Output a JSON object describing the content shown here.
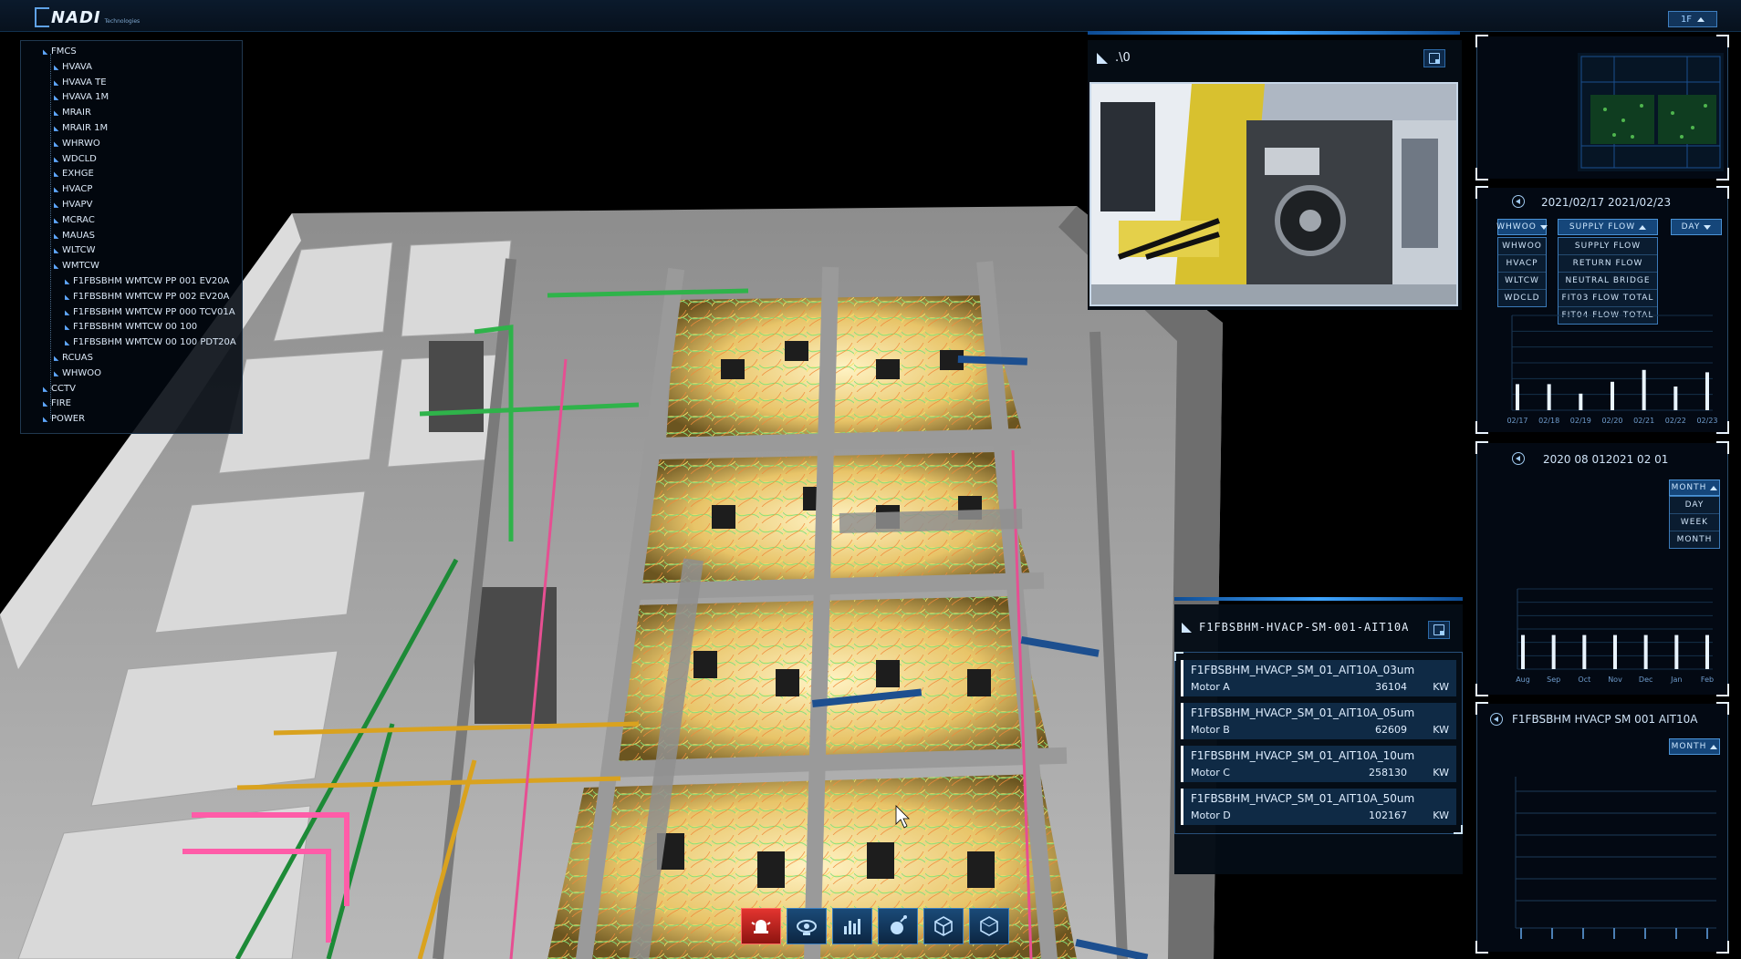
{
  "brand": {
    "name": "NADI",
    "tagline": "Technologies"
  },
  "floor_selector": {
    "value": "1F"
  },
  "tree": [
    {
      "label": "FMCS",
      "depth": 0
    },
    {
      "label": "HVAVA",
      "depth": 1
    },
    {
      "label": "HVAVA TE",
      "depth": 1
    },
    {
      "label": "HVAVA 1M",
      "depth": 1
    },
    {
      "label": "MRAIR",
      "depth": 1
    },
    {
      "label": "MRAIR 1M",
      "depth": 1
    },
    {
      "label": "WHRWO",
      "depth": 1
    },
    {
      "label": "WDCLD",
      "depth": 1
    },
    {
      "label": "EXHGE",
      "depth": 1
    },
    {
      "label": "HVACP",
      "depth": 1
    },
    {
      "label": "HVAPV",
      "depth": 1
    },
    {
      "label": "MCRAC",
      "depth": 1
    },
    {
      "label": "MAUAS",
      "depth": 1
    },
    {
      "label": "WLTCW",
      "depth": 1
    },
    {
      "label": "WMTCW",
      "depth": 1
    },
    {
      "label": "F1FBSBHM WMTCW PP 001 EV20A",
      "depth": 2
    },
    {
      "label": "F1FBSBHM WMTCW PP 002 EV20A",
      "depth": 2
    },
    {
      "label": "F1FBSBHM WMTCW PP 000 TCV01A",
      "depth": 2
    },
    {
      "label": "F1FBSBHM WMTCW 00 100",
      "depth": 2
    },
    {
      "label": "F1FBSBHM WMTCW 00 100 PDT20A",
      "depth": 2
    },
    {
      "label": "RCUAS",
      "depth": 1
    },
    {
      "label": "WHWOO",
      "depth": 1
    },
    {
      "label": "CCTV",
      "depth": 0
    },
    {
      "label": "FIRE",
      "depth": 0
    },
    {
      "label": "POWER",
      "depth": 0
    }
  ],
  "camera": {
    "title": ".\\0"
  },
  "sensor_panel": {
    "title": "F1FBSBHM-HVACP-SM-001-AIT10A",
    "rows": [
      {
        "name": "F1FBSBHM_HVACP_SM_01_AIT10A_03um",
        "motor": "Motor A",
        "value": "36104",
        "unit": "KW"
      },
      {
        "name": "F1FBSBHM_HVACP_SM_01_AIT10A_05um",
        "motor": "Motor B",
        "value": "62609",
        "unit": "KW"
      },
      {
        "name": "F1FBSBHM_HVACP_SM_01_AIT10A_10um",
        "motor": "Motor C",
        "value": "258130",
        "unit": "KW"
      },
      {
        "name": "F1FBSBHM_HVACP_SM_01_AIT10A_50um",
        "motor": "Motor D",
        "value": "102167",
        "unit": "KW"
      }
    ]
  },
  "flow_panel": {
    "date_range": "2021/02/17 2021/02/23",
    "system_select": {
      "value": "WHWOO",
      "options": [
        "WHWOO",
        "HVACP",
        "WLTCW",
        "WDCLD"
      ]
    },
    "metric_select": {
      "value": "SUPPLY FLOW",
      "options": [
        "SUPPLY FLOW",
        "RETURN FLOW",
        "NEUTRAL BRIDGE",
        "FIT03 FLOW TOTAL",
        "FIT04 FLOW TOTAL"
      ]
    },
    "period_select": {
      "value": "DAY"
    }
  },
  "monthly_panel": {
    "date_range": "2020 08 012021 02 01",
    "period_select": {
      "value": "MONTH",
      "options": [
        "DAY",
        "WEEK",
        "MONTH"
      ]
    }
  },
  "sensor_chart_panel": {
    "title": "F1FBSBHM HVACP SM 001 AIT10A",
    "period_select": {
      "value": "MONTH"
    }
  },
  "chart_data": [
    {
      "type": "bar",
      "categories": [
        "02/17",
        "02/18",
        "02/19",
        "02/20",
        "02/21",
        "02/22",
        "02/23"
      ],
      "values": [
        0.55,
        0.55,
        0.35,
        0.6,
        0.85,
        0.5,
        0.8
      ]
    },
    {
      "type": "bar",
      "categories": [
        "Aug",
        "Sep",
        "Oct",
        "Nov",
        "Dec",
        "Jan",
        "Feb"
      ],
      "values": [
        0.85,
        0.85,
        0.85,
        0.85,
        0.85,
        0.85,
        0.85
      ]
    }
  ],
  "toolbar": [
    {
      "icon": "alarm-icon",
      "active": true
    },
    {
      "icon": "camera-icon",
      "active": false
    },
    {
      "icon": "bar-chart-icon",
      "active": false
    },
    {
      "icon": "sensor-icon",
      "active": false
    },
    {
      "icon": "cube-icon",
      "active": false
    },
    {
      "icon": "cube-outline-icon",
      "active": false
    }
  ],
  "colors": {
    "accent": "#3fa5ff",
    "alarm": "#e3342f",
    "panel_bg": "#050c14"
  }
}
